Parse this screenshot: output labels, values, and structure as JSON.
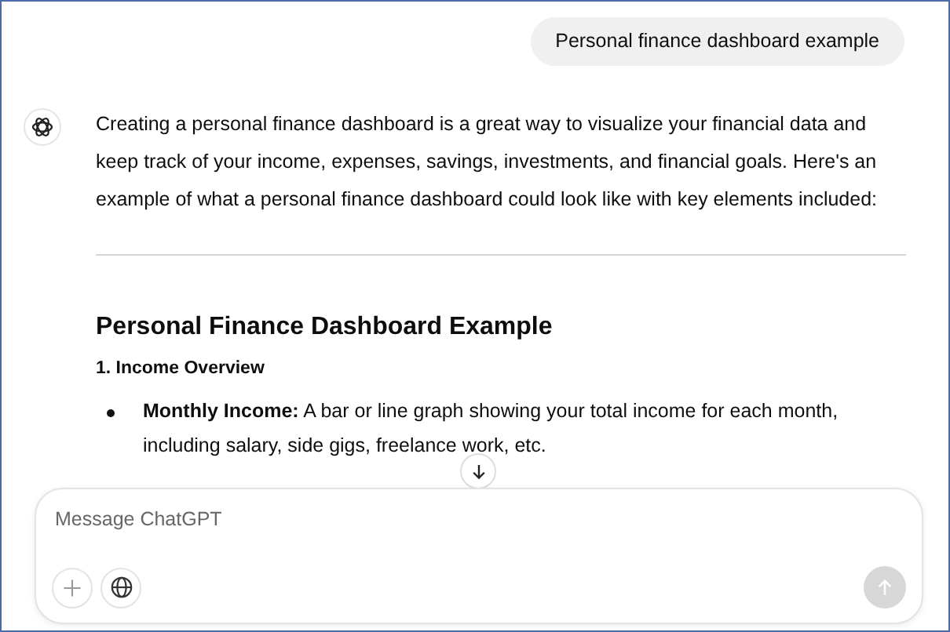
{
  "user_message": "Personal finance dashboard example",
  "assistant": {
    "intro": "Creating a personal finance dashboard is a great way to visualize your financial data and keep track of your income, expenses, savings, investments, and financial goals. Here's an example of what a personal finance dashboard could look like with key elements included:",
    "heading": "Personal Finance Dashboard Example",
    "subheading": "1. Income Overview",
    "bullets": [
      {
        "text": "**Monthly Income:** A bar or line graph showing your total income for each month, including salary, side gigs, freelance work, etc."
      }
    ]
  },
  "composer": {
    "placeholder": "Message ChatGPT",
    "send_disabled": true
  }
}
